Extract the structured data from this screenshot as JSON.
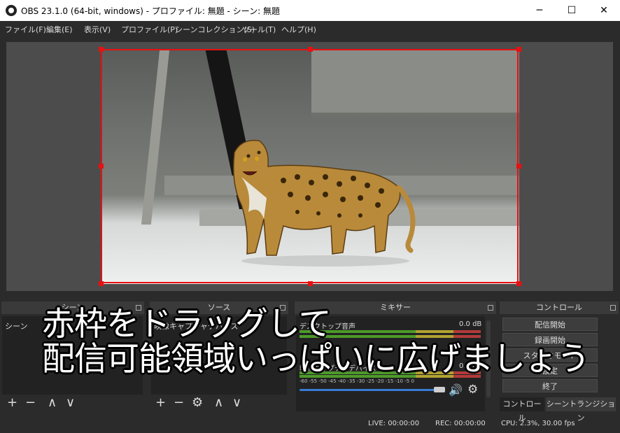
{
  "window": {
    "title": "OBS 23.1.0 (64-bit, windows) - プロファイル: 無題 - シーン: 無題",
    "minimize_glyph": "─",
    "maximize_glyph": "☐",
    "close_glyph": "✕"
  },
  "menu": [
    "ファイル(F)",
    "編集(E)",
    "表示(V)",
    "プロファイル(P)",
    "シーンコレクション(S)",
    "ツール(T)",
    "ヘルプ(H)"
  ],
  "docks": {
    "scenes": {
      "title": "シーン",
      "header": "シーン"
    },
    "sources": {
      "title": "ソース",
      "item": "映像キャプチャデバイス"
    },
    "mixer": {
      "title": "ミキサー"
    },
    "controls": {
      "title": "コントロール"
    }
  },
  "toolbar": {
    "add": "+",
    "remove": "−",
    "up": "∧",
    "down": "∨",
    "settings": "⚙"
  },
  "mixer": {
    "channels": [
      {
        "name": "デスクトップ音声",
        "db": "0.0 dB"
      },
      {
        "name": "映像キャプチャデバイス",
        "db": "0.0 dB"
      }
    ],
    "ticks": "-60  -55  -50  -45  -40  -35  -30  -25  -20  -15  -10   -5    0",
    "volume": 1.0
  },
  "controls": {
    "start_streaming": "配信開始",
    "start_recording": "録画開始",
    "studio_mode": "スタジオモード",
    "settings": "設定",
    "exit": "終了",
    "tab_controls": "コントロール",
    "tab_transitions": "シーントランジション"
  },
  "status": {
    "live": "LIVE: 00:00:00",
    "rec": "REC: 00:00:00",
    "cpu": "CPU: 2.3%, 30.00 fps"
  },
  "overlay": {
    "line1": "赤枠をドラッグして",
    "line2": "配信可能領域いっぱいに広げましょう"
  },
  "colors": {
    "selection": "#e81010",
    "volume": "#3a7bd5"
  }
}
